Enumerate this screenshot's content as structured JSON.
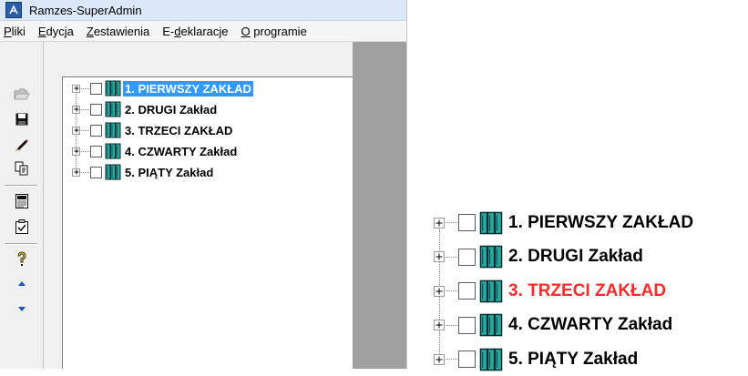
{
  "window": {
    "title": "Ramzes-SuperAdmin",
    "app_icon": "app-logo-icon"
  },
  "menu": [
    {
      "label": "Pliki",
      "underline_index": 0
    },
    {
      "label": "Edycja",
      "underline_index": 0
    },
    {
      "label": "Zestawienia",
      "underline_index": 0
    },
    {
      "label": "E-deklaracje",
      "underline_index": 2
    },
    {
      "label": "O programie",
      "underline_index": 0
    }
  ],
  "toolbar": [
    {
      "name": "open-folder-icon",
      "disabled": true
    },
    {
      "name": "save-icon"
    },
    {
      "name": "edit-pencil-icon"
    },
    {
      "name": "copy-icon"
    },
    {
      "name": "pit-form-icon"
    },
    {
      "name": "checklist-icon"
    },
    {
      "name": "help-icon"
    },
    {
      "name": "arrow-up-icon"
    },
    {
      "name": "arrow-down-icon"
    }
  ],
  "tree": {
    "items": [
      {
        "label": "1. PIERWSZY ZAKŁAD",
        "selected": true
      },
      {
        "label": "2. DRUGI Zakład"
      },
      {
        "label": "3. TRZECI ZAKŁAD"
      },
      {
        "label": "4. CZWARTY Zakład"
      },
      {
        "label": "5. PIĄTY Zakład"
      }
    ]
  },
  "zoomed_tree": {
    "items": [
      {
        "label": "1. PIERWSZY ZAKŁAD"
      },
      {
        "label": "2. DRUGI Zakład"
      },
      {
        "label": "3. TRZECI ZAKŁAD",
        "color": "#ff2b2b"
      },
      {
        "label": "4. CZWARTY Zakład"
      },
      {
        "label": "5. PIĄTY Zakład"
      }
    ]
  },
  "colors": {
    "selection": "#3399ff",
    "highlight_text": "#ff2b2b",
    "book_icon": "#2aa7a0"
  }
}
